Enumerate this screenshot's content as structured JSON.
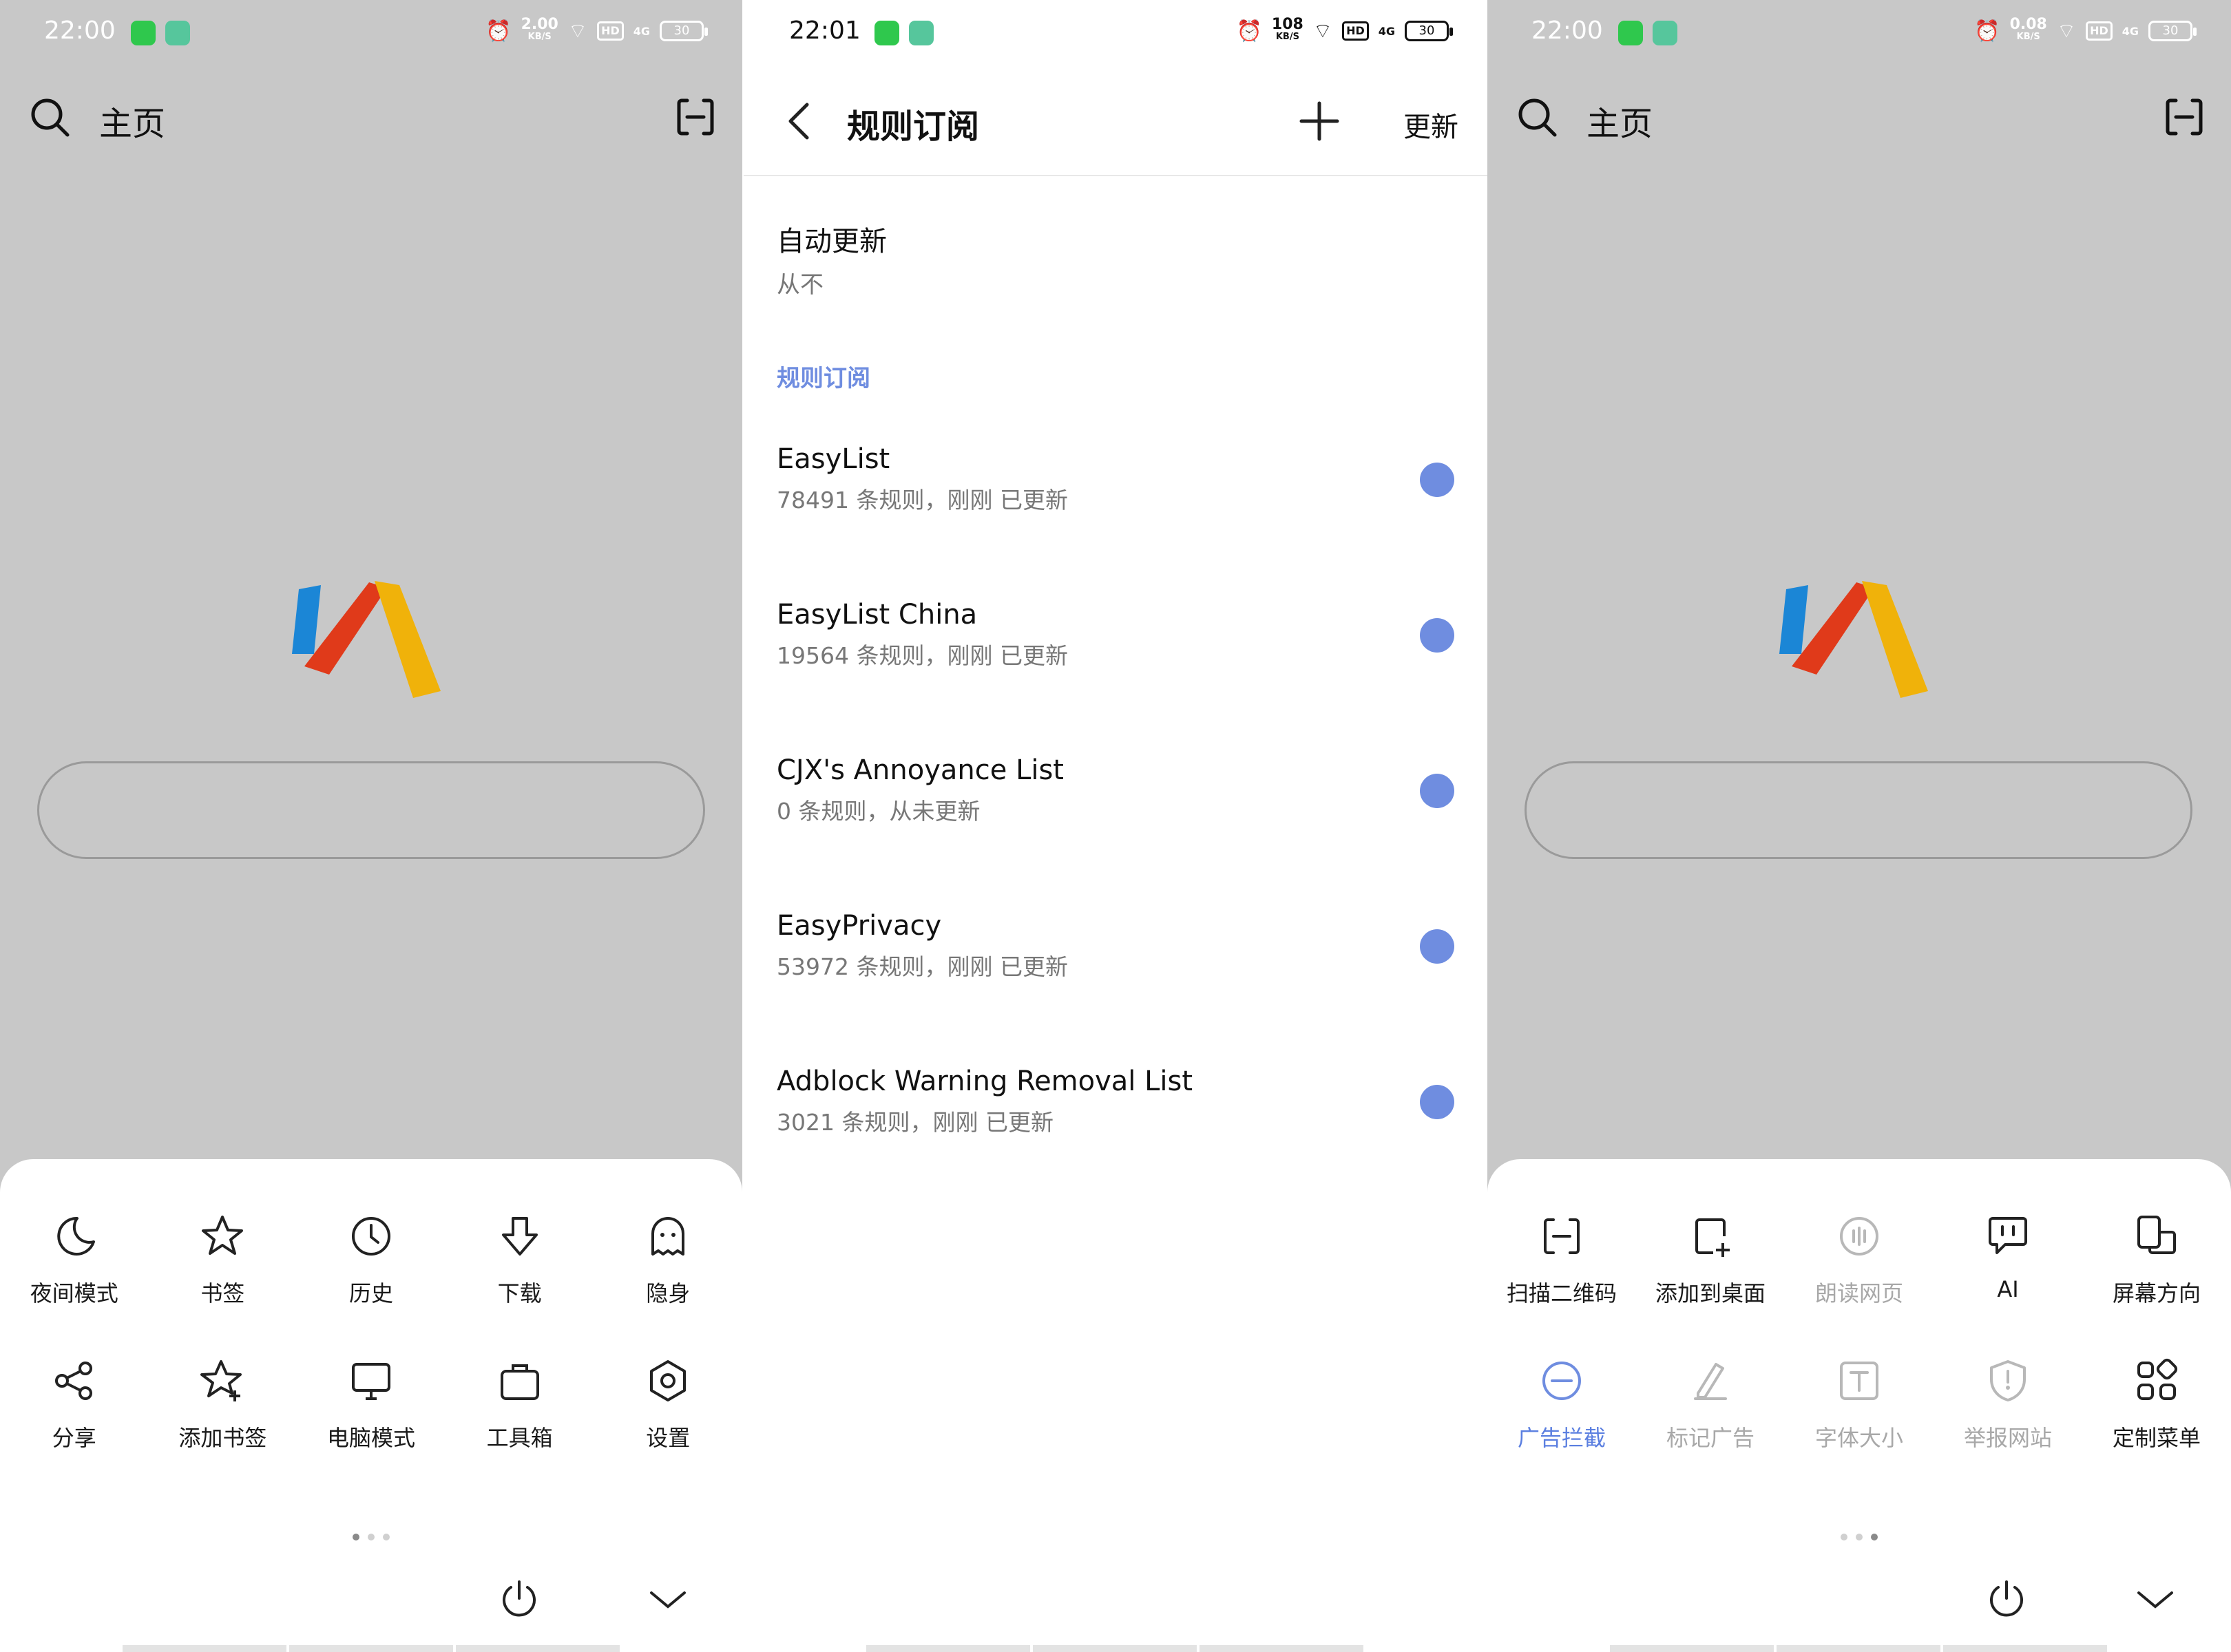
{
  "colors": {
    "accent": "#6f8de0",
    "scrim": "#c8c8c8",
    "dimmed_text": "#a8a8a8"
  },
  "left_screen": {
    "status": {
      "time": "22:00",
      "speed_value": "2.00",
      "speed_unit": "KB/S",
      "hd": "HD",
      "signal": "4G",
      "battery": "30"
    },
    "home": {
      "title": "主页"
    },
    "menu": {
      "items": [
        {
          "label": "夜间模式",
          "icon": "moon-icon"
        },
        {
          "label": "书签",
          "icon": "star-icon"
        },
        {
          "label": "历史",
          "icon": "clock-icon"
        },
        {
          "label": "下载",
          "icon": "download-icon"
        },
        {
          "label": "隐身",
          "icon": "ghost-icon"
        },
        {
          "label": "分享",
          "icon": "share-icon"
        },
        {
          "label": "添加书签",
          "icon": "star-plus-icon"
        },
        {
          "label": "电脑模式",
          "icon": "monitor-icon"
        },
        {
          "label": "工具箱",
          "icon": "toolbox-icon"
        },
        {
          "label": "设置",
          "icon": "settings-icon"
        }
      ],
      "page_indicator": {
        "pages": 3,
        "current": 1
      }
    }
  },
  "middle_screen": {
    "status": {
      "time": "22:01",
      "speed_value": "108",
      "speed_unit": "KB/S",
      "hd": "HD",
      "signal": "4G",
      "battery": "30"
    },
    "appbar": {
      "title": "规则订阅",
      "update_label": "更新"
    },
    "auto_update": {
      "title": "自动更新",
      "value": "从不"
    },
    "section_title": "规则订阅",
    "subscriptions": [
      {
        "name": "EasyList",
        "detail": "78491 条规则，刚刚 已更新",
        "enabled": true
      },
      {
        "name": "EasyList China",
        "detail": "19564 条规则，刚刚 已更新",
        "enabled": true
      },
      {
        "name": "CJX's Annoyance List",
        "detail": "0 条规则，从未更新",
        "enabled": true
      },
      {
        "name": "EasyPrivacy",
        "detail": "53972 条规则，刚刚 已更新",
        "enabled": true
      },
      {
        "name": "Adblock Warning Removal List",
        "detail": "3021 条规则，刚刚 已更新",
        "enabled": true
      }
    ]
  },
  "right_screen": {
    "status": {
      "time": "22:00",
      "speed_value": "0.08",
      "speed_unit": "KB/S",
      "hd": "HD",
      "signal": "4G",
      "battery": "30"
    },
    "home": {
      "title": "主页"
    },
    "menu": {
      "items": [
        {
          "label": "扫描二维码",
          "icon": "scan-icon",
          "state": "normal"
        },
        {
          "label": "添加到桌面",
          "icon": "add-to-desktop-icon",
          "state": "normal"
        },
        {
          "label": "朗读网页",
          "icon": "read-aloud-icon",
          "state": "disabled"
        },
        {
          "label": "AI",
          "icon": "ai-chat-icon",
          "state": "normal"
        },
        {
          "label": "屏幕方向",
          "icon": "screen-rotate-icon",
          "state": "normal"
        },
        {
          "label": "广告拦截",
          "icon": "ad-block-icon",
          "state": "active"
        },
        {
          "label": "标记广告",
          "icon": "mark-ad-icon",
          "state": "disabled"
        },
        {
          "label": "字体大小",
          "icon": "font-size-icon",
          "state": "disabled"
        },
        {
          "label": "举报网站",
          "icon": "report-icon",
          "state": "disabled"
        },
        {
          "label": "定制菜单",
          "icon": "custom-menu-icon",
          "state": "normal"
        }
      ],
      "page_indicator": {
        "pages": 3,
        "current": 3
      }
    }
  }
}
